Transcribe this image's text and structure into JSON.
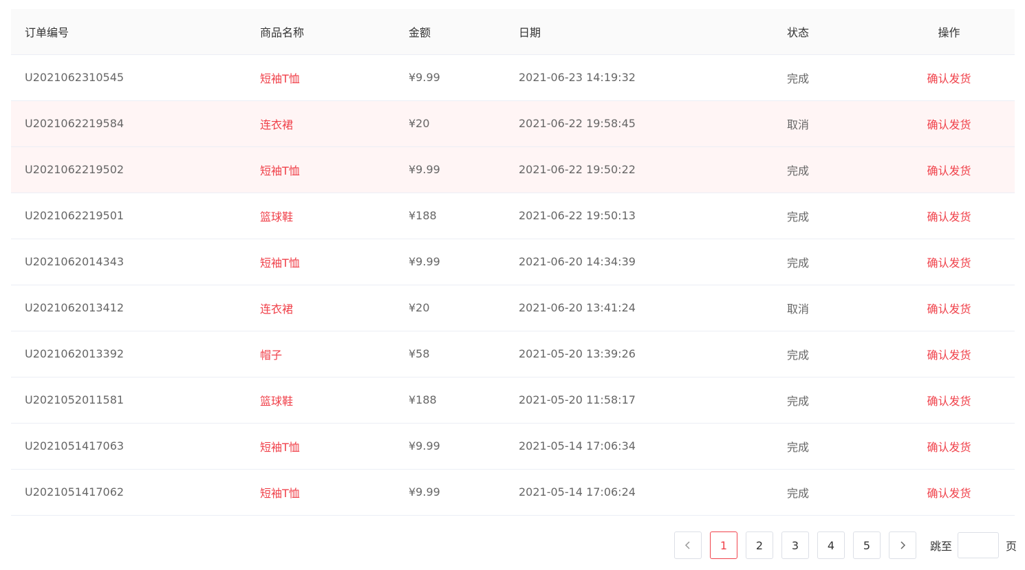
{
  "table": {
    "headers": {
      "order_id": "订单编号",
      "product": "商品名称",
      "amount": "金额",
      "date": "日期",
      "status": "状态",
      "action": "操作"
    },
    "rows": [
      {
        "order_id": "U2021062310545",
        "product": "短袖T恤",
        "amount": "¥9.99",
        "date": "2021-06-23 14:19:32",
        "status": "完成",
        "action": "确认发货"
      },
      {
        "order_id": "U2021062219584",
        "product": "连衣裙",
        "amount": "¥20",
        "date": "2021-06-22 19:58:45",
        "status": "取消",
        "action": "确认发货"
      },
      {
        "order_id": "U2021062219502",
        "product": "短袖T恤",
        "amount": "¥9.99",
        "date": "2021-06-22 19:50:22",
        "status": "完成",
        "action": "确认发货"
      },
      {
        "order_id": "U2021062219501",
        "product": "篮球鞋",
        "amount": "¥188",
        "date": "2021-06-22 19:50:13",
        "status": "完成",
        "action": "确认发货"
      },
      {
        "order_id": "U2021062014343",
        "product": "短袖T恤",
        "amount": "¥9.99",
        "date": "2021-06-20 14:34:39",
        "status": "完成",
        "action": "确认发货"
      },
      {
        "order_id": "U2021062013412",
        "product": "连衣裙",
        "amount": "¥20",
        "date": "2021-06-20 13:41:24",
        "status": "取消",
        "action": "确认发货"
      },
      {
        "order_id": "U2021062013392",
        "product": "帽子",
        "amount": "¥58",
        "date": "2021-05-20 13:39:26",
        "status": "完成",
        "action": "确认发货"
      },
      {
        "order_id": "U2021052011581",
        "product": "篮球鞋",
        "amount": "¥188",
        "date": "2021-05-20 11:58:17",
        "status": "完成",
        "action": "确认发货"
      },
      {
        "order_id": "U2021051417063",
        "product": "短袖T恤",
        "amount": "¥9.99",
        "date": "2021-05-14 17:06:34",
        "status": "完成",
        "action": "确认发货"
      },
      {
        "order_id": "U2021051417062",
        "product": "短袖T恤",
        "amount": "¥9.99",
        "date": "2021-05-14 17:06:24",
        "status": "完成",
        "action": "确认发货"
      }
    ]
  },
  "pagination": {
    "prev_icon": "chevron-left-icon",
    "next_icon": "chevron-right-icon",
    "pages": [
      "1",
      "2",
      "3",
      "4",
      "5"
    ],
    "current_page": "1",
    "jump_label": "跳至",
    "jump_value": "",
    "page_suffix": "页"
  },
  "colors": {
    "accent": "#f0424b",
    "header_bg": "#fafafa",
    "highlight_row_bg": "#fff5f5",
    "border": "#ebeef5"
  }
}
